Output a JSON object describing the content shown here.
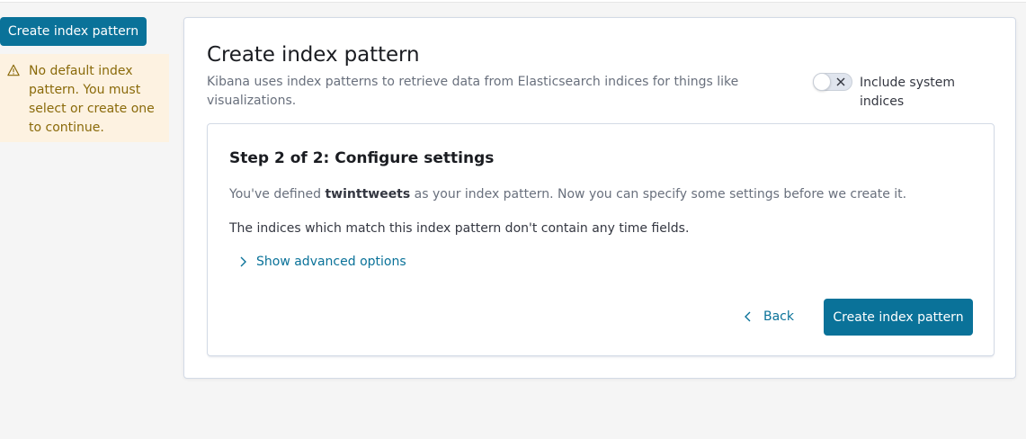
{
  "sidebar": {
    "create_button_label": "Create index pattern",
    "callout_text": "No default index pattern. You must select or create one to continue."
  },
  "header": {
    "title": "Create index pattern",
    "description": "Kibana uses index patterns to retrieve data from Elasticsearch indices for things like visualizations.",
    "toggle_label": "Include system indices",
    "toggle_on": false
  },
  "step": {
    "title": "Step 2 of 2: Configure settings",
    "defined_prefix": "You've defined ",
    "pattern_name": "twinttweets",
    "defined_suffix": " as your index pattern. Now you can specify some settings before we create it.",
    "no_time_fields": "The indices which match this index pattern don't contain any time fields.",
    "advanced_link": "Show advanced options",
    "back_label": "Back",
    "create_label": "Create index pattern"
  },
  "colors": {
    "primary": "#0a7299",
    "warning_bg": "#fdf2e1",
    "warning_text": "#8a6a0a"
  }
}
